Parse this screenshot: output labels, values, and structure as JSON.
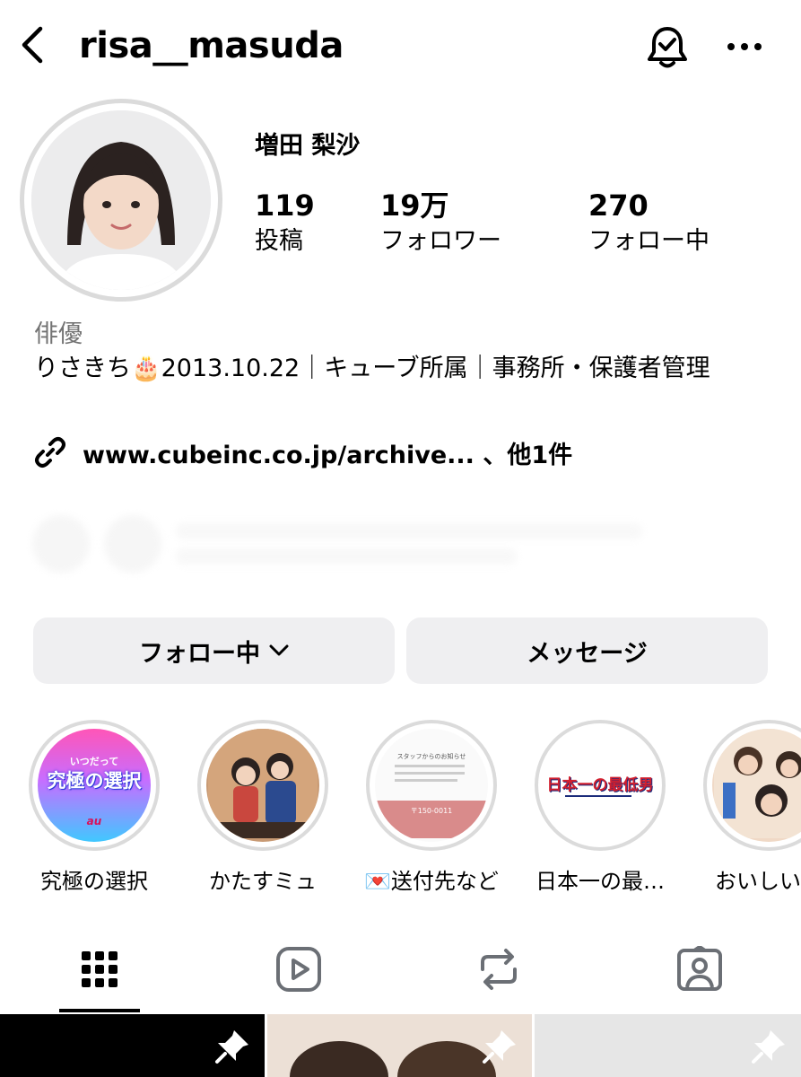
{
  "header": {
    "username": "risa__masuda"
  },
  "profile": {
    "display_name": "増田 梨沙",
    "stats": [
      {
        "value": "119",
        "label": "投稿"
      },
      {
        "value": "19万",
        "label": "フォロワー"
      },
      {
        "value": "270",
        "label": "フォロー中"
      }
    ],
    "category": "俳優",
    "bio": "りさきち🎂2013.10.22｜キューブ所属｜事務所・保護者管理",
    "link": "www.cubeinc.co.jp/archive... 、他1件"
  },
  "actions": {
    "follow_label": "フォロー中",
    "message_label": "メッセージ"
  },
  "highlights": [
    {
      "label": "究極の選択",
      "cover_text": "究極の選択",
      "cover_sub": "いつだって",
      "cover_brand": "au"
    },
    {
      "label": "かたすミュ"
    },
    {
      "label": "💌送付先など",
      "cover_text": "スタッフからのお知らせ",
      "cover_address": "〒150-0011"
    },
    {
      "label": "日本一の最…",
      "cover_text": "日本一の最低男"
    },
    {
      "label": "おいしい献"
    }
  ],
  "tabs": [
    "grid-icon",
    "reels-icon",
    "reposts-icon",
    "tagged-icon"
  ],
  "colors": {
    "button_bg": "#efeff1",
    "ring": "#dbdbdb",
    "secondary_text": "#737373"
  }
}
